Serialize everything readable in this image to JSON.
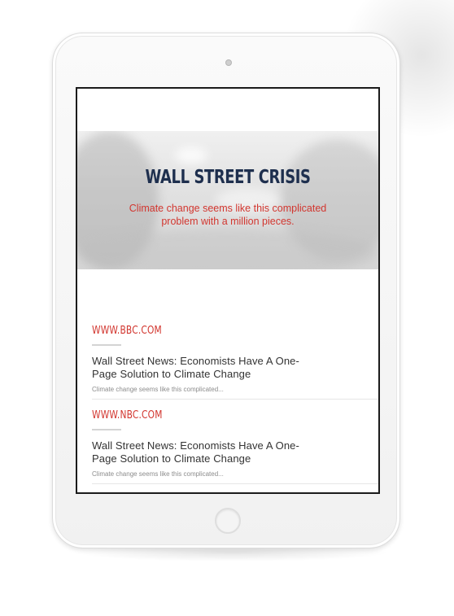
{
  "hero": {
    "title": "WALL STREET CRISIS",
    "subtitle": "Climate change seems like this complicated problem with a million pieces."
  },
  "articles": [
    {
      "source": "WWW.BBC.COM",
      "headline": "Wall Street News: Economists Have A One-Page Solution to Climate Change",
      "snippet": "Climate change seems like this complicated..."
    },
    {
      "source": "WWW.NBC.COM",
      "headline": "Wall Street News: Economists Have A One-Page Solution to Climate Change",
      "snippet": "Climate change seems like this complicated..."
    }
  ],
  "colors": {
    "accent_red": "#d2362f",
    "title_navy": "#1e2f4e",
    "device_frame": "#f4f4f4"
  },
  "icons": {
    "camera": "camera-icon",
    "home": "home-button-icon"
  }
}
